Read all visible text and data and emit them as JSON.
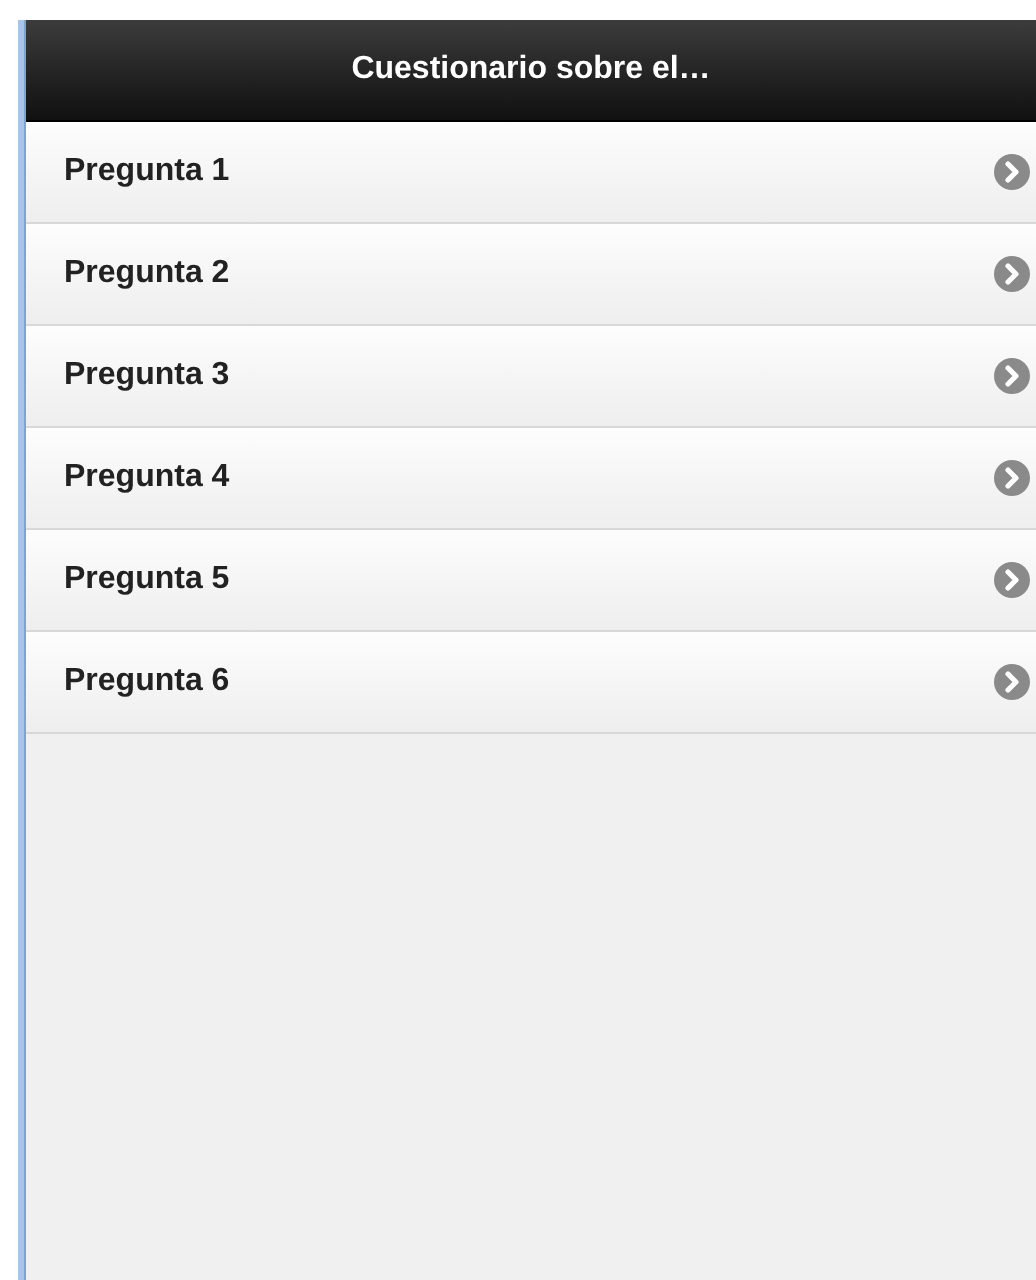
{
  "header": {
    "title": "Cuestionario sobre el…"
  },
  "list": {
    "items": [
      {
        "label": "Pregunta 1"
      },
      {
        "label": "Pregunta 2"
      },
      {
        "label": "Pregunta 3"
      },
      {
        "label": "Pregunta 4"
      },
      {
        "label": "Pregunta 5"
      },
      {
        "label": "Pregunta 6"
      }
    ]
  }
}
